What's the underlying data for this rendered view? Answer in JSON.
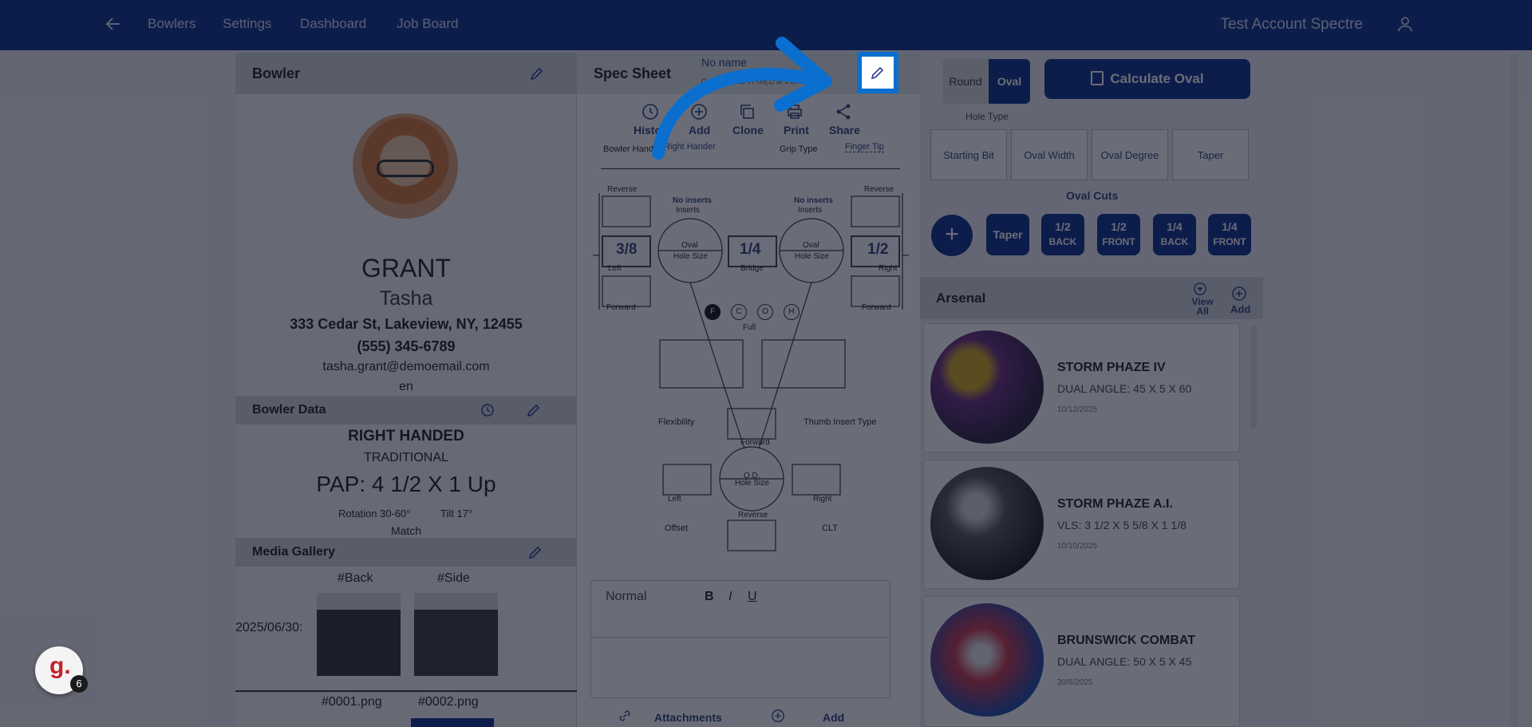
{
  "nav": {
    "items": [
      "Bowlers",
      "Settings",
      "Dashboard",
      "Job Board"
    ],
    "account": "Test Account Spectre"
  },
  "bowler": {
    "header": "Bowler",
    "last_name": "GRANT",
    "first_name": "Tasha",
    "address": "333 Cedar St, Lakeview, NY, 12455",
    "phone": "(555) 345-6789",
    "email": "tasha.grant@demoemail.com",
    "language": "en",
    "data_header": "Bowler Data",
    "hand": "RIGHT HANDED",
    "style": "TRADITIONAL",
    "pap": "PAP: 4 1/2 X 1 Up",
    "rotation": "Rotation 30-60°",
    "tilt": "Tilt 17°",
    "match": "Match",
    "media_header": "Media Gallery",
    "media_back": "#Back",
    "media_side": "#Side",
    "media_date": "2025/06/30:",
    "file1": "#0001.png",
    "file2": "#0002.png"
  },
  "spec": {
    "header": "Spec Sheet",
    "name": "No name",
    "timestamp": "Created 2025-07-09(1) at 9:20 AM",
    "actions": [
      "History",
      "Add",
      "Clone",
      "Print",
      "Share"
    ],
    "bowler_hand_label": "Bowler Hand",
    "bowler_hand_value": "Right Hander",
    "grip_type_label": "Grip Type",
    "grip_type_value": "Finger Tip",
    "reverse_l": "Reverse",
    "reverse_r": "Reverse",
    "no_inserts_l": "No inserts",
    "no_inserts_r": "No inserts",
    "inserts": "Inserts",
    "left_pitch": "3/8",
    "bridge": "1/4",
    "right_pitch": "1/2",
    "oval": "Oval",
    "hole_size": "Hole Size",
    "left": "Left",
    "right": "Right",
    "bridge_label": "Bridge",
    "forward": "Forward",
    "fit_options": [
      "F",
      "C",
      "O",
      "H"
    ],
    "full": "Full",
    "flexibility": "Flexibility",
    "thumb_insert_type": "Thumb Insert Type",
    "od": "O.D.",
    "offset": "Offset",
    "clt": "CLT",
    "editor_style": "Normal",
    "attachments": "Attachments",
    "add": "Add"
  },
  "right": {
    "round": "Round",
    "oval": "Oval",
    "calc": "Calculate Oval",
    "hole_type": "Hole Type",
    "fields": [
      "Starting Bit",
      "Oval Width",
      "Oval Degree",
      "Taper"
    ],
    "oval_cuts": "Oval Cuts",
    "cuts": [
      {
        "top": "Taper",
        "bottom": ""
      },
      {
        "top": "1/2",
        "bottom": "BACK"
      },
      {
        "top": "1/2",
        "bottom": "FRONT"
      },
      {
        "top": "1/4",
        "bottom": "BACK"
      },
      {
        "top": "1/4",
        "bottom": "FRONT"
      }
    ],
    "arsenal": "Arsenal",
    "view_all": "View All",
    "add": "Add",
    "balls": [
      {
        "name": "STORM PHAZE IV",
        "layout": "DUAL ANGLE: 45 X 5 X 60",
        "date": "10/12/2025"
      },
      {
        "name": "STORM PHAZE A.I.",
        "layout": "VLS: 3 1/2 X 5 5/8 X 1 1/8",
        "date": "10/10/2025"
      },
      {
        "name": "BRUNSWICK COMBAT",
        "layout": "DUAL ANGLE: 50 X 5 X 45",
        "date": "30/6/2025"
      }
    ]
  },
  "guide": {
    "logo": "g.",
    "count": "6"
  },
  "colors": {
    "nav": "#0c2d8c",
    "highlight": "#0a6fce",
    "badge": "#c4202a"
  }
}
